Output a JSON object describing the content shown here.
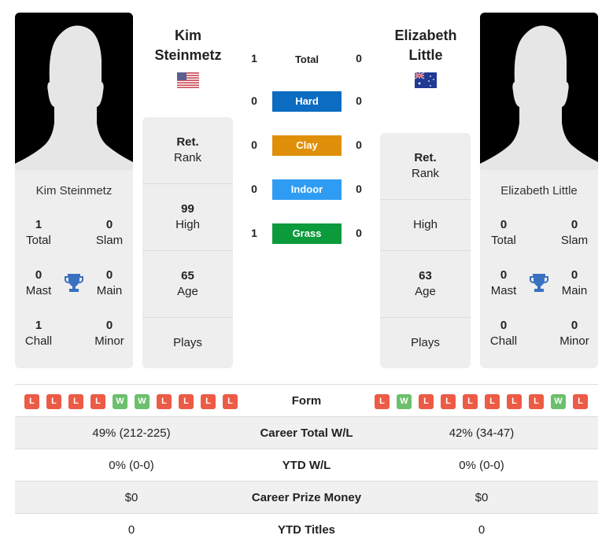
{
  "players": {
    "left": {
      "name": "Kim Steinmetz",
      "name_line1": "Kim",
      "name_line2": "Steinmetz",
      "flag": "usa-flag-icon",
      "card": {
        "total": {
          "value": "1",
          "label": "Total"
        },
        "slam": {
          "value": "0",
          "label": "Slam"
        },
        "mast": {
          "value": "0",
          "label": "Mast"
        },
        "main": {
          "value": "0",
          "label": "Main"
        },
        "chall": {
          "value": "1",
          "label": "Chall"
        },
        "minor": {
          "value": "0",
          "label": "Minor"
        }
      },
      "side": {
        "rank": {
          "value": "Ret.",
          "label": "Rank"
        },
        "high": {
          "value": "99",
          "label": "High"
        },
        "age": {
          "value": "65",
          "label": "Age"
        },
        "plays": {
          "value": "",
          "label": "Plays"
        }
      },
      "form": [
        "L",
        "L",
        "L",
        "L",
        "W",
        "W",
        "L",
        "L",
        "L",
        "L"
      ]
    },
    "right": {
      "name": "Elizabeth Little",
      "name_line1": "Elizabeth",
      "name_line2": "Little",
      "flag": "australia-flag-icon",
      "card": {
        "total": {
          "value": "0",
          "label": "Total"
        },
        "slam": {
          "value": "0",
          "label": "Slam"
        },
        "mast": {
          "value": "0",
          "label": "Mast"
        },
        "main": {
          "value": "0",
          "label": "Main"
        },
        "chall": {
          "value": "0",
          "label": "Chall"
        },
        "minor": {
          "value": "0",
          "label": "Minor"
        }
      },
      "side": {
        "rank": {
          "value": "Ret.",
          "label": "Rank"
        },
        "high": {
          "value": "",
          "label": "High"
        },
        "age": {
          "value": "63",
          "label": "Age"
        },
        "plays": {
          "value": "",
          "label": "Plays"
        }
      },
      "form": [
        "L",
        "W",
        "L",
        "L",
        "L",
        "L",
        "L",
        "L",
        "W",
        "L"
      ]
    }
  },
  "h2h": [
    {
      "label": "Total",
      "left": "1",
      "right": "0",
      "color": null
    },
    {
      "label": "Hard",
      "left": "0",
      "right": "0",
      "color": "#0b6cc1"
    },
    {
      "label": "Clay",
      "left": "0",
      "right": "0",
      "color": "#e08f0a"
    },
    {
      "label": "Indoor",
      "left": "0",
      "right": "0",
      "color": "#2f9cf4"
    },
    {
      "label": "Grass",
      "left": "1",
      "right": "0",
      "color": "#0b9a3c"
    }
  ],
  "stats_rows": [
    {
      "label": "Form",
      "left": "",
      "right": ""
    },
    {
      "label": "Career Total W/L",
      "left": "49% (212-225)",
      "right": "42% (34-47)"
    },
    {
      "label": "YTD W/L",
      "left": "0% (0-0)",
      "right": "0% (0-0)"
    },
    {
      "label": "Career Prize Money",
      "left": "$0",
      "right": "$0"
    },
    {
      "label": "YTD Titles",
      "left": "0",
      "right": "0"
    }
  ],
  "colors": {
    "win": "#6cbf6c",
    "loss": "#ec5b45",
    "trophy": "#3a70c0"
  }
}
